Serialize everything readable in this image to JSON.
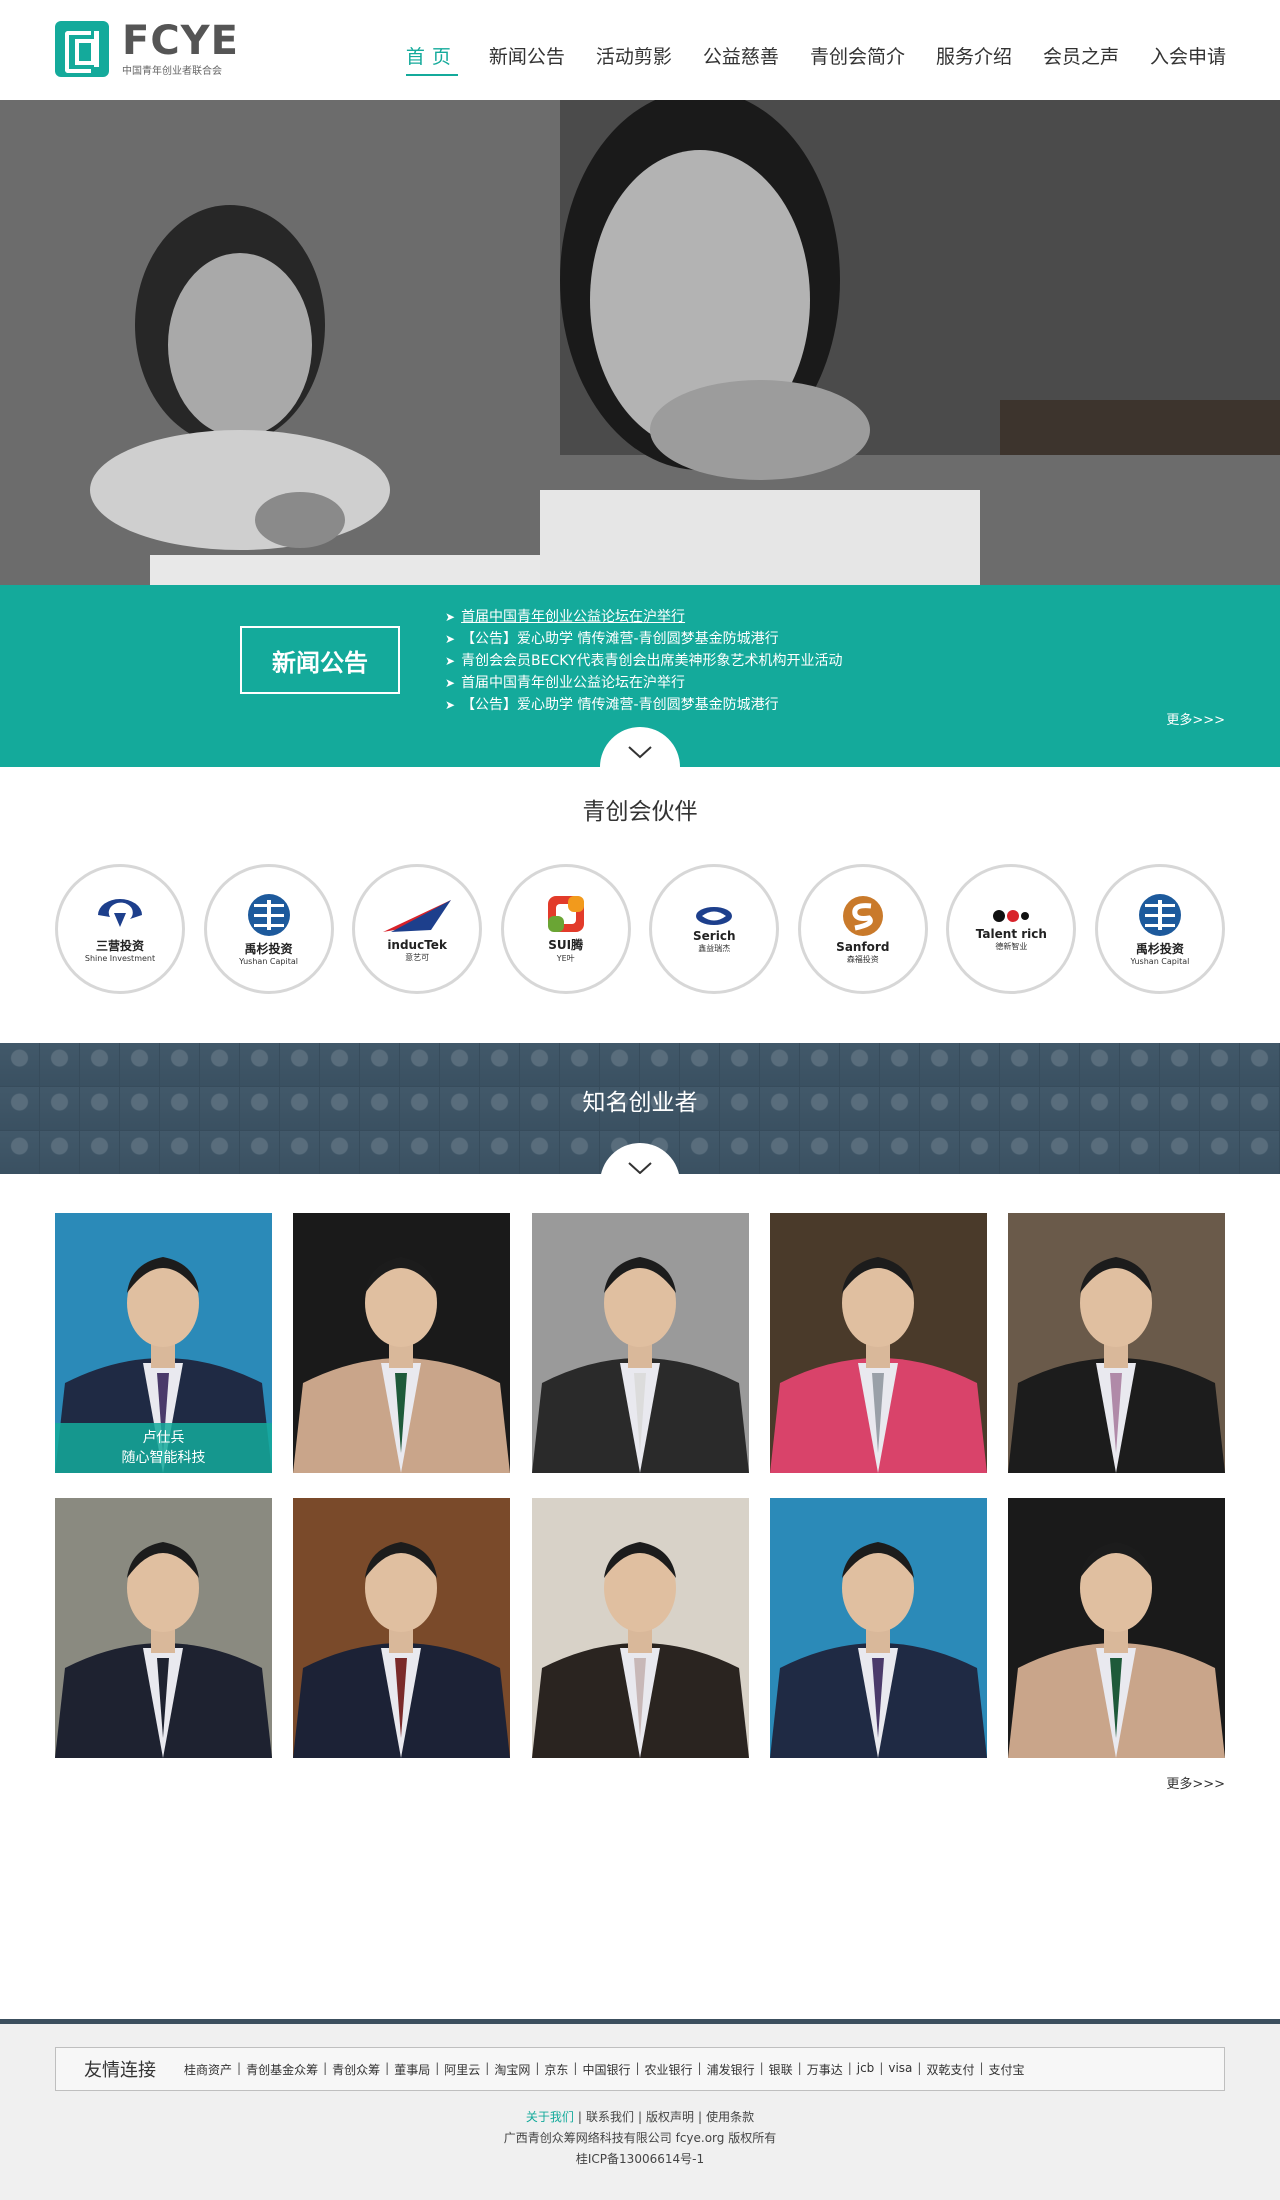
{
  "header": {
    "logo_text": "FCYE",
    "logo_subtitle": "中国青年创业者联合会",
    "nav": [
      {
        "label": "首页",
        "active": true
      },
      {
        "label": "新闻公告",
        "active": false
      },
      {
        "label": "活动剪影",
        "active": false
      },
      {
        "label": "公益慈善",
        "active": false
      },
      {
        "label": "青创会简介",
        "active": false
      },
      {
        "label": "服务介绍",
        "active": false
      },
      {
        "label": "会员之声",
        "active": false
      },
      {
        "label": "入会申请",
        "active": false
      }
    ]
  },
  "news": {
    "title": "新闻公告",
    "items": [
      "首届中国青年创业公益论坛在沪举行",
      "【公告】爱心助学 情传滩营-青创圆梦基金防城港行",
      "青创会会员BECKY代表青创会出席美神形象艺术机构开业活动",
      "首届中国青年创业公益论坛在沪举行",
      "【公告】爱心助学 情传滩营-青创圆梦基金防城港行"
    ],
    "more": "更多>>>"
  },
  "partners": {
    "title": "青创会伙伴",
    "items": [
      {
        "name": "三营投资",
        "sub": "Shine Investment",
        "icon": "shine-investment-logo-icon"
      },
      {
        "name": "禹杉投资",
        "sub": "Yushan Capital",
        "icon": "yushan-capital-logo-icon"
      },
      {
        "name": "inducTek",
        "sub": "意艺可",
        "icon": "inductek-logo-icon"
      },
      {
        "name": "SUI腾",
        "sub": "YE叶",
        "icon": "suiye-logo-icon"
      },
      {
        "name": "Serich",
        "sub": "鑫益瑞杰",
        "icon": "serich-logo-icon"
      },
      {
        "name": "Sanford",
        "sub": "森福投资",
        "icon": "sanford-logo-icon"
      },
      {
        "name": "Talent rich",
        "sub": "德新智业",
        "icon": "talent-rich-logo-icon"
      },
      {
        "name": "禹杉投资",
        "sub": "Yushan Capital",
        "icon": "yushan-capital-logo-icon"
      }
    ]
  },
  "entrepreneurs": {
    "title": "知名创业者",
    "people": [
      {
        "name": "卢仕兵",
        "company": "随心智能科技",
        "bg": "#2b8ab8",
        "suit": "#1f2a44",
        "tie": "#4a3a6a",
        "captioned": true
      },
      {
        "name": "",
        "company": "",
        "bg": "#1a1a1a",
        "suit": "#c9a58a",
        "tie": "#1e5a3a",
        "captioned": false
      },
      {
        "name": "",
        "company": "",
        "bg": "#9a9a9a",
        "suit": "#2a2a2a",
        "tie": "#dcdcdc",
        "captioned": false
      },
      {
        "name": "",
        "company": "",
        "bg": "#4a3a2a",
        "suit": "#d9436a",
        "tie": "#9aa0a8",
        "captioned": false
      },
      {
        "name": "",
        "company": "",
        "bg": "#6a5a4a",
        "suit": "#1c1c1c",
        "tie": "#b08aa8",
        "captioned": false
      },
      {
        "name": "",
        "company": "",
        "bg": "#8a8a80",
        "suit": "#1e2230",
        "tie": "#1e2230",
        "captioned": false
      },
      {
        "name": "",
        "company": "",
        "bg": "#7a4a2a",
        "suit": "#1c2236",
        "tie": "#7a2a2a",
        "captioned": false
      },
      {
        "name": "",
        "company": "",
        "bg": "#d8d2c8",
        "suit": "#2a2420",
        "tie": "#c8b8b8",
        "captioned": false
      },
      {
        "name": "",
        "company": "",
        "bg": "#2b8ab8",
        "suit": "#1f2a44",
        "tie": "#4a3a6a",
        "captioned": false
      },
      {
        "name": "",
        "company": "",
        "bg": "#1a1a1a",
        "suit": "#c9a58a",
        "tie": "#1e5a3a",
        "captioned": false
      }
    ],
    "more": "更多>>>"
  },
  "footer": {
    "links_title": "友情连接",
    "links": [
      "桂商资产",
      "青创基金众筹",
      "青创众筹",
      "董事局",
      "阿里云",
      "淘宝网",
      "京东",
      "中国银行",
      "农业银行",
      "浦发银行",
      "银联",
      "万事达",
      "jcb",
      "visa",
      "双乾支付",
      "支付宝"
    ],
    "nav": [
      {
        "label": "关于我们",
        "highlight": true
      },
      {
        "label": "联系我们",
        "highlight": false
      },
      {
        "label": "版权声明",
        "highlight": false
      },
      {
        "label": "使用条款",
        "highlight": false
      }
    ],
    "copyright": "广西青创众筹网络科技有限公司 fcye.org 版权所有",
    "icp": "桂ICP备13006614号-1"
  },
  "colors": {
    "accent": "#14aa9b",
    "footer_rule": "#3c4f5e",
    "band": "#3e5566"
  }
}
